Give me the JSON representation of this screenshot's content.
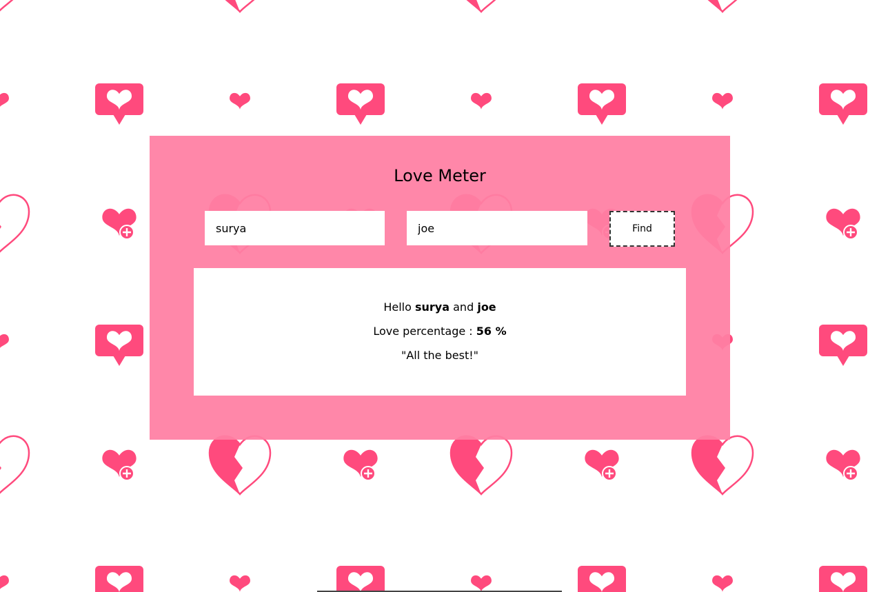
{
  "colors": {
    "heart": "#ff4a7d",
    "card": "#ff80a4",
    "panel": "#ffffff"
  },
  "app": {
    "title": "Love Meter"
  },
  "form": {
    "name1_value": "surya",
    "name2_value": "joe",
    "find_label": "Find"
  },
  "result": {
    "greeting": "Hello",
    "name1": "surya",
    "conjunction": "and",
    "name2": "joe",
    "percentage_label": "Love percentage :",
    "percentage_value": "56 %",
    "message": "\"All the best!\""
  },
  "background": {
    "pattern_icons": [
      "heart-speech-bubble-icon",
      "small-heart-icon",
      "broken-heart-icon",
      "heart-plus-icon"
    ]
  }
}
